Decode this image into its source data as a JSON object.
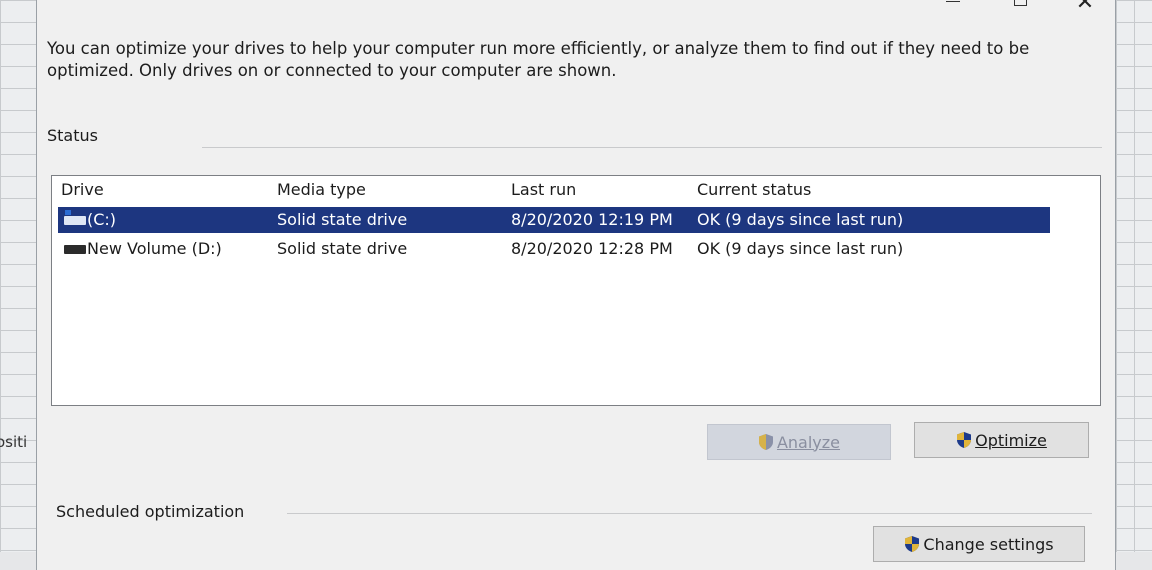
{
  "window": {
    "minimize_label": "—",
    "close_label": "✕"
  },
  "background": {
    "left_cell_text": "ositi"
  },
  "intro": {
    "text": "You can optimize your drives to help your computer run more efficiently, or analyze them to find out if they need to be optimized. Only drives on or connected to your computer are shown."
  },
  "status_group": {
    "label": "Status"
  },
  "drives_table": {
    "columns": [
      "Drive",
      "Media type",
      "Last run",
      "Current status"
    ],
    "rows": [
      {
        "drive": "(C:)",
        "media_type": "Solid state drive",
        "last_run": "8/20/2020 12:19 PM",
        "current_status": "OK (9 days since last run)",
        "selected": true,
        "icon": "system-drive-icon"
      },
      {
        "drive": "New Volume (D:)",
        "media_type": "Solid state drive",
        "last_run": "8/20/2020 12:28 PM",
        "current_status": "OK (9 days since last run)",
        "selected": false,
        "icon": "drive-icon"
      }
    ]
  },
  "buttons": {
    "analyze": {
      "label": "Analyze",
      "enabled": false,
      "icon": "shield-icon"
    },
    "optimize": {
      "label": "Optimize",
      "enabled": true,
      "icon": "shield-icon"
    },
    "change_settings": {
      "label": "Change settings",
      "icon": "shield-icon"
    }
  },
  "scheduled_group": {
    "label": "Scheduled optimization"
  },
  "colors": {
    "selection": "#1d3680",
    "window_bg": "#f0f0f0"
  }
}
